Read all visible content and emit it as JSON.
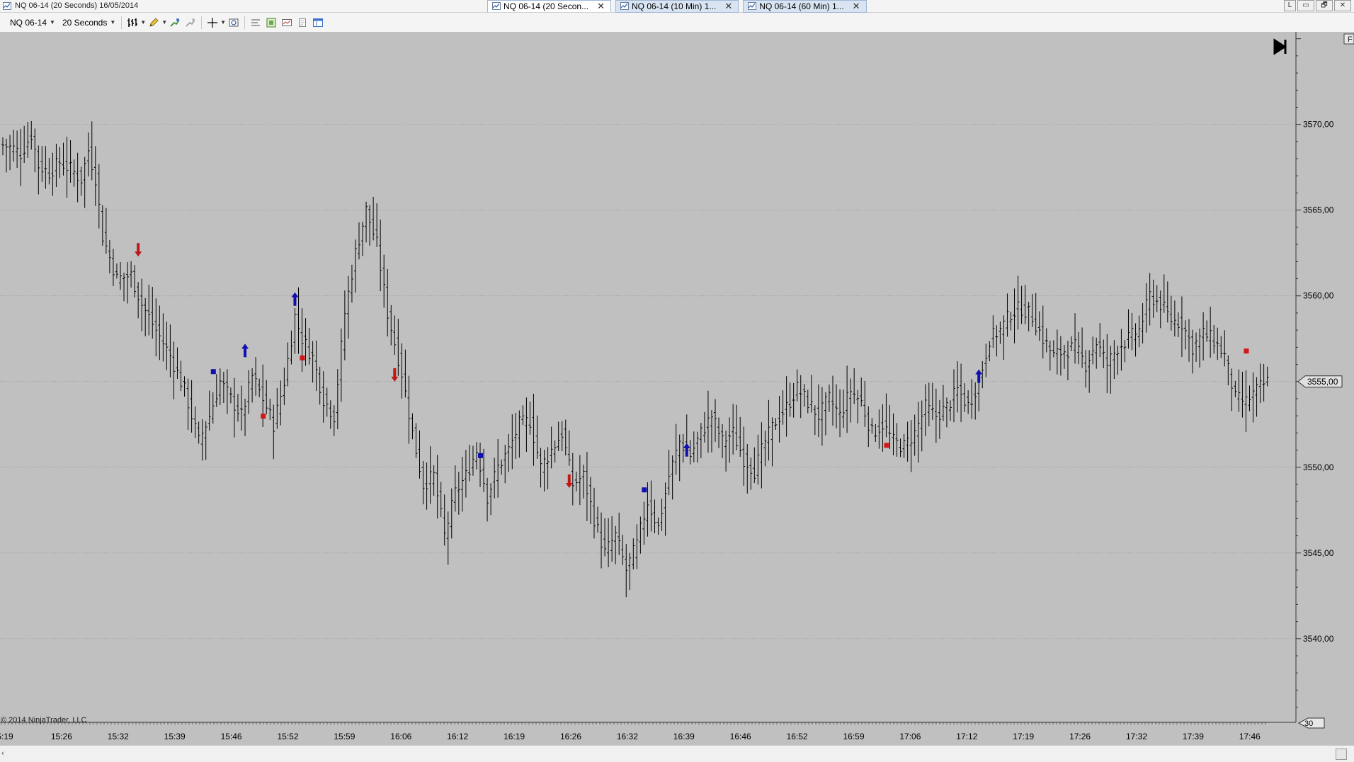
{
  "window": {
    "title": "NQ 06-14 (20 Seconds)  16/05/2014"
  },
  "tabs": [
    {
      "label": "NQ 06-14 (20 Secon...",
      "active": true
    },
    {
      "label": "NQ 06-14 (10 Min)  1...",
      "active": false
    },
    {
      "label": "NQ 06-14 (60 Min)  1...",
      "active": false
    }
  ],
  "window_controls": {
    "link": "L",
    "minimize": "▭",
    "restore": "🗗",
    "close": "✕"
  },
  "toolbar": {
    "instrument": "NQ 06-14",
    "interval": "20 Seconds"
  },
  "icons": {
    "bar_type": "bar-type-icon",
    "drawing": "pencil-icon",
    "indicators": "indicator-icon",
    "strategies": "strategy-icon",
    "crosshair": "crosshair-icon",
    "zoom": "zoom-icon",
    "properties": "properties-icon",
    "data_box": "data-box-icon",
    "chart_trader": "chart-trader-icon",
    "scroll_end": "scroll-to-end-icon"
  },
  "chart_data": {
    "type": "ohlc",
    "x_labels": [
      "5:19",
      "15:26",
      "15:32",
      "15:39",
      "15:46",
      "15:52",
      "15:59",
      "16:06",
      "16:12",
      "16:19",
      "16:26",
      "16:32",
      "16:39",
      "16:46",
      "16:52",
      "16:59",
      "17:06",
      "17:12",
      "17:19",
      "17:26",
      "17:32",
      "17:39",
      "17:46"
    ],
    "y_ticks": [
      "3570,00",
      "3565,00",
      "3560,00",
      "3555,00",
      "3550,00",
      "3545,00",
      "3540,00"
    ],
    "y_tick_values": [
      3570,
      3565,
      3560,
      3555,
      3550,
      3545,
      3540
    ],
    "ylim": [
      3535.2,
      3575.4
    ],
    "current_price": 3555.0,
    "current_price_label": "3555,00",
    "price_path": [
      [
        0,
        3568.8
      ],
      [
        3,
        3568.6
      ],
      [
        5,
        3568.3
      ],
      [
        8,
        3569.4
      ],
      [
        10,
        3567.6
      ],
      [
        13,
        3567.2
      ],
      [
        16,
        3567.8
      ],
      [
        19,
        3567.4
      ],
      [
        22,
        3566.8
      ],
      [
        24,
        3568.5
      ],
      [
        26,
        3566.9
      ],
      [
        28,
        3563.5
      ],
      [
        32,
        3561.0
      ],
      [
        36,
        3561.2
      ],
      [
        39,
        3559.5
      ],
      [
        43,
        3558.0
      ],
      [
        47,
        3556.5
      ],
      [
        51,
        3554.5
      ],
      [
        55,
        3551.5
      ],
      [
        58,
        3553.0
      ],
      [
        61,
        3555.0
      ],
      [
        64,
        3554.0
      ],
      [
        67,
        3553.0
      ],
      [
        70,
        3555.3
      ],
      [
        73,
        3554.0
      ],
      [
        76,
        3552.5
      ],
      [
        79,
        3555.0
      ],
      [
        82,
        3558.8
      ],
      [
        84,
        3557.5
      ],
      [
        87,
        3556.4
      ],
      [
        90,
        3554.0
      ],
      [
        93,
        3553.0
      ],
      [
        96,
        3559.0
      ],
      [
        99,
        3562.5
      ],
      [
        102,
        3565.0
      ],
      [
        105,
        3563.0
      ],
      [
        108,
        3559.0
      ],
      [
        112,
        3555.5
      ],
      [
        115,
        3552.0
      ],
      [
        118,
        3549.0
      ],
      [
        121,
        3549.5
      ],
      [
        124,
        3546.0
      ],
      [
        127,
        3548.5
      ],
      [
        130,
        3549.5
      ],
      [
        133,
        3551.0
      ],
      [
        136,
        3548.3
      ],
      [
        139,
        3550.0
      ],
      [
        142,
        3551.0
      ],
      [
        145,
        3552.5
      ],
      [
        148,
        3552.7
      ],
      [
        151,
        3550.0
      ],
      [
        154,
        3551.0
      ],
      [
        157,
        3552.0
      ],
      [
        160,
        3549.0
      ],
      [
        163,
        3549.5
      ],
      [
        166,
        3547.0
      ],
      [
        169,
        3545.0
      ],
      [
        172,
        3546.0
      ],
      [
        175,
        3544.0
      ],
      [
        178,
        3545.5
      ],
      [
        181,
        3548.0
      ],
      [
        184,
        3546.5
      ],
      [
        187,
        3549.5
      ],
      [
        190,
        3551.5
      ],
      [
        193,
        3550.7
      ],
      [
        196,
        3552.0
      ],
      [
        199,
        3553.0
      ],
      [
        202,
        3551.5
      ],
      [
        205,
        3552.0
      ],
      [
        208,
        3550.5
      ],
      [
        211,
        3549.8
      ],
      [
        214,
        3551.5
      ],
      [
        217,
        3552.7
      ],
      [
        220,
        3553.5
      ],
      [
        223,
        3554.6
      ],
      [
        226,
        3553.8
      ],
      [
        229,
        3553.0
      ],
      [
        232,
        3554.0
      ],
      [
        235,
        3553.0
      ],
      [
        238,
        3554.5
      ],
      [
        241,
        3553.8
      ],
      [
        244,
        3552.0
      ],
      [
        247,
        3552.5
      ],
      [
        250,
        3551.5
      ],
      [
        253,
        3551.2
      ],
      [
        256,
        3552.0
      ],
      [
        259,
        3553.5
      ],
      [
        262,
        3553.0
      ],
      [
        265,
        3553.5
      ],
      [
        268,
        3554.5
      ],
      [
        271,
        3553.6
      ],
      [
        274,
        3555.0
      ],
      [
        277,
        3557.5
      ],
      [
        280,
        3558.0
      ],
      [
        283,
        3559.0
      ],
      [
        286,
        3559.3
      ],
      [
        289,
        3558.8
      ],
      [
        292,
        3557.5
      ],
      [
        295,
        3556.5
      ],
      [
        298,
        3556.8
      ],
      [
        301,
        3557.0
      ],
      [
        304,
        3556.0
      ],
      [
        307,
        3557.3
      ],
      [
        310,
        3556.0
      ],
      [
        313,
        3557.0
      ],
      [
        316,
        3557.5
      ],
      [
        319,
        3558.0
      ],
      [
        322,
        3560.0
      ],
      [
        325,
        3559.5
      ],
      [
        328,
        3558.6
      ],
      [
        331,
        3558.4
      ],
      [
        334,
        3557.0
      ],
      [
        337,
        3557.8
      ],
      [
        340,
        3557.4
      ],
      [
        343,
        3556.5
      ],
      [
        346,
        3554.0
      ],
      [
        349,
        3553.8
      ],
      [
        352,
        3554.5
      ],
      [
        355,
        3555.0
      ]
    ],
    "markers": [
      {
        "i": 38,
        "type": "down",
        "price": 3562.5
      },
      {
        "i": 59,
        "type": "square_blue",
        "price": 3555.6
      },
      {
        "i": 68,
        "type": "up",
        "price": 3557.0
      },
      {
        "i": 73,
        "type": "square_red",
        "price": 3553.0
      },
      {
        "i": 82,
        "type": "up",
        "price": 3560.0
      },
      {
        "i": 84,
        "type": "square_red",
        "price": 3556.4
      },
      {
        "i": 110,
        "type": "down",
        "price": 3555.2
      },
      {
        "i": 134,
        "type": "square_blue",
        "price": 3550.7
      },
      {
        "i": 159,
        "type": "down",
        "price": 3549.0
      },
      {
        "i": 180,
        "type": "square_blue",
        "price": 3548.7
      },
      {
        "i": 192,
        "type": "up",
        "price": 3551.2
      },
      {
        "i": 248,
        "type": "square_red",
        "price": 3551.3
      },
      {
        "i": 274,
        "type": "up",
        "price": 3555.5
      },
      {
        "i": 349,
        "type": "square_red",
        "price": 3556.8
      }
    ]
  },
  "footer": {
    "copyright": "© 2014 NinjaTrader, LLC",
    "bars_back": "30",
    "panel_flag": "F"
  },
  "scrollbar": {
    "left_arrow": "‹"
  }
}
